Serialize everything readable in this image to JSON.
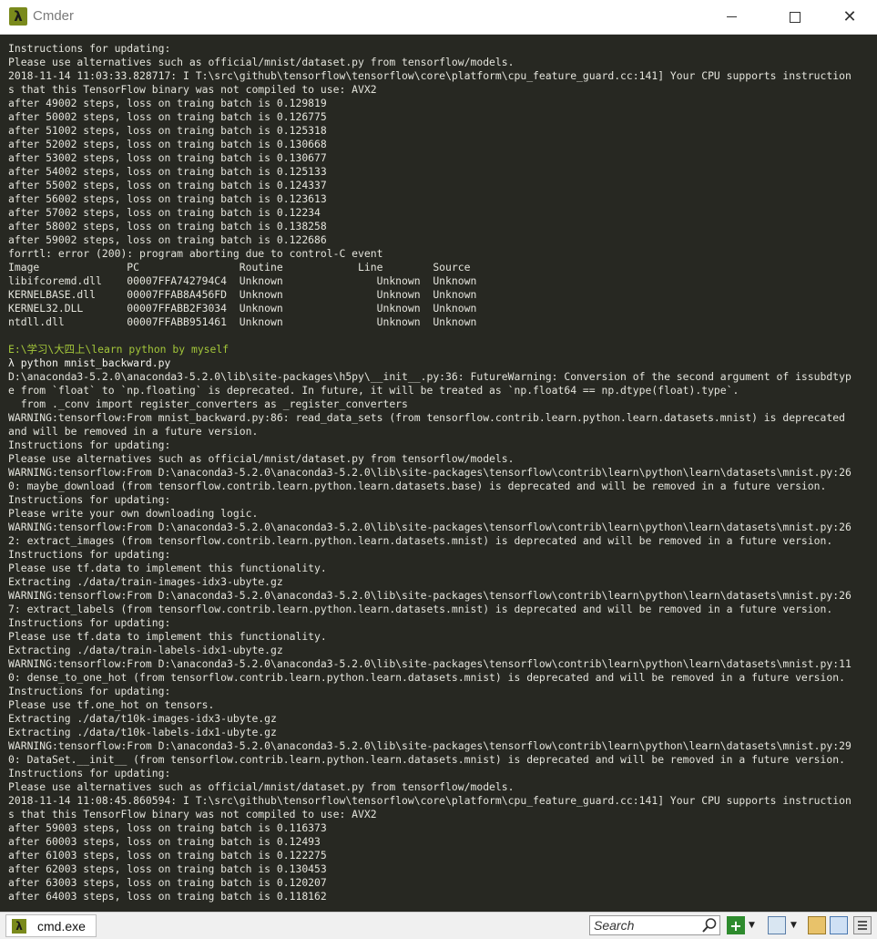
{
  "window": {
    "title": "Cmder",
    "icon_glyph": "λ",
    "minimize_icon": "minimize-icon",
    "maximize_icon": "maximize-icon",
    "close_glyph": "✕"
  },
  "console": {
    "lines": [
      {
        "text": "Instructions for updating:",
        "kind": "text"
      },
      {
        "text": "Please use alternatives such as official/mnist/dataset.py from tensorflow/models.",
        "kind": "text"
      },
      {
        "text": "2018-11-14 11:03:33.828717: I T:\\src\\github\\tensorflow\\tensorflow\\core\\platform\\cpu_feature_guard.cc:141] Your CPU supports instruction",
        "kind": "text"
      },
      {
        "text": "s that this TensorFlow binary was not compiled to use: AVX2",
        "kind": "text"
      },
      {
        "text": "after 49002 steps, loss on traing batch is 0.129819",
        "kind": "text"
      },
      {
        "text": "after 50002 steps, loss on traing batch is 0.126775",
        "kind": "text"
      },
      {
        "text": "after 51002 steps, loss on traing batch is 0.125318",
        "kind": "text"
      },
      {
        "text": "after 52002 steps, loss on traing batch is 0.130668",
        "kind": "text"
      },
      {
        "text": "after 53002 steps, loss on traing batch is 0.130677",
        "kind": "text"
      },
      {
        "text": "after 54002 steps, loss on traing batch is 0.125133",
        "kind": "text"
      },
      {
        "text": "after 55002 steps, loss on traing batch is 0.124337",
        "kind": "text"
      },
      {
        "text": "after 56002 steps, loss on traing batch is 0.123613",
        "kind": "text"
      },
      {
        "text": "after 57002 steps, loss on traing batch is 0.12234",
        "kind": "text"
      },
      {
        "text": "after 58002 steps, loss on traing batch is 0.138258",
        "kind": "text"
      },
      {
        "text": "after 59002 steps, loss on traing batch is 0.122686",
        "kind": "text"
      },
      {
        "text": "forrtl: error (200): program aborting due to control-C event",
        "kind": "text"
      },
      {
        "text": "Image              PC                Routine            Line        Source",
        "kind": "text"
      },
      {
        "text": "libifcoremd.dll    00007FFA742794C4  Unknown               Unknown  Unknown",
        "kind": "text"
      },
      {
        "text": "KERNELBASE.dll     00007FFAB8A456FD  Unknown               Unknown  Unknown",
        "kind": "text"
      },
      {
        "text": "KERNEL32.DLL       00007FFABB2F3034  Unknown               Unknown  Unknown",
        "kind": "text"
      },
      {
        "text": "ntdll.dll          00007FFABB951461  Unknown               Unknown  Unknown",
        "kind": "text"
      },
      {
        "text": "",
        "kind": "text"
      },
      {
        "text": "E:\\学习\\大四上\\learn python by myself",
        "kind": "path"
      },
      {
        "text": "λ python mnist_backward.py",
        "kind": "prompt"
      },
      {
        "text": "D:\\anaconda3-5.2.0\\anaconda3-5.2.0\\lib\\site-packages\\h5py\\__init__.py:36: FutureWarning: Conversion of the second argument of issubdtyp",
        "kind": "text"
      },
      {
        "text": "e from `float` to `np.floating` is deprecated. In future, it will be treated as `np.float64 == np.dtype(float).type`.",
        "kind": "text"
      },
      {
        "text": "  from ._conv import register_converters as _register_converters",
        "kind": "text"
      },
      {
        "text": "WARNING:tensorflow:From mnist_backward.py:86: read_data_sets (from tensorflow.contrib.learn.python.learn.datasets.mnist) is deprecated",
        "kind": "text"
      },
      {
        "text": "and will be removed in a future version.",
        "kind": "text"
      },
      {
        "text": "Instructions for updating:",
        "kind": "text"
      },
      {
        "text": "Please use alternatives such as official/mnist/dataset.py from tensorflow/models.",
        "kind": "text"
      },
      {
        "text": "WARNING:tensorflow:From D:\\anaconda3-5.2.0\\anaconda3-5.2.0\\lib\\site-packages\\tensorflow\\contrib\\learn\\python\\learn\\datasets\\mnist.py:26",
        "kind": "text"
      },
      {
        "text": "0: maybe_download (from tensorflow.contrib.learn.python.learn.datasets.base) is deprecated and will be removed in a future version.",
        "kind": "text"
      },
      {
        "text": "Instructions for updating:",
        "kind": "text"
      },
      {
        "text": "Please write your own downloading logic.",
        "kind": "text"
      },
      {
        "text": "WARNING:tensorflow:From D:\\anaconda3-5.2.0\\anaconda3-5.2.0\\lib\\site-packages\\tensorflow\\contrib\\learn\\python\\learn\\datasets\\mnist.py:26",
        "kind": "text"
      },
      {
        "text": "2: extract_images (from tensorflow.contrib.learn.python.learn.datasets.mnist) is deprecated and will be removed in a future version.",
        "kind": "text"
      },
      {
        "text": "Instructions for updating:",
        "kind": "text"
      },
      {
        "text": "Please use tf.data to implement this functionality.",
        "kind": "text"
      },
      {
        "text": "Extracting ./data/train-images-idx3-ubyte.gz",
        "kind": "text"
      },
      {
        "text": "WARNING:tensorflow:From D:\\anaconda3-5.2.0\\anaconda3-5.2.0\\lib\\site-packages\\tensorflow\\contrib\\learn\\python\\learn\\datasets\\mnist.py:26",
        "kind": "text"
      },
      {
        "text": "7: extract_labels (from tensorflow.contrib.learn.python.learn.datasets.mnist) is deprecated and will be removed in a future version.",
        "kind": "text"
      },
      {
        "text": "Instructions for updating:",
        "kind": "text"
      },
      {
        "text": "Please use tf.data to implement this functionality.",
        "kind": "text"
      },
      {
        "text": "Extracting ./data/train-labels-idx1-ubyte.gz",
        "kind": "text"
      },
      {
        "text": "WARNING:tensorflow:From D:\\anaconda3-5.2.0\\anaconda3-5.2.0\\lib\\site-packages\\tensorflow\\contrib\\learn\\python\\learn\\datasets\\mnist.py:11",
        "kind": "text"
      },
      {
        "text": "0: dense_to_one_hot (from tensorflow.contrib.learn.python.learn.datasets.mnist) is deprecated and will be removed in a future version.",
        "kind": "text"
      },
      {
        "text": "Instructions for updating:",
        "kind": "text"
      },
      {
        "text": "Please use tf.one_hot on tensors.",
        "kind": "text"
      },
      {
        "text": "Extracting ./data/t10k-images-idx3-ubyte.gz",
        "kind": "text"
      },
      {
        "text": "Extracting ./data/t10k-labels-idx1-ubyte.gz",
        "kind": "text"
      },
      {
        "text": "WARNING:tensorflow:From D:\\anaconda3-5.2.0\\anaconda3-5.2.0\\lib\\site-packages\\tensorflow\\contrib\\learn\\python\\learn\\datasets\\mnist.py:29",
        "kind": "text"
      },
      {
        "text": "0: DataSet.__init__ (from tensorflow.contrib.learn.python.learn.datasets.mnist) is deprecated and will be removed in a future version.",
        "kind": "text"
      },
      {
        "text": "Instructions for updating:",
        "kind": "text"
      },
      {
        "text": "Please use alternatives such as official/mnist/dataset.py from tensorflow/models.",
        "kind": "text"
      },
      {
        "text": "2018-11-14 11:08:45.860594: I T:\\src\\github\\tensorflow\\tensorflow\\core\\platform\\cpu_feature_guard.cc:141] Your CPU supports instruction",
        "kind": "text"
      },
      {
        "text": "s that this TensorFlow binary was not compiled to use: AVX2",
        "kind": "text"
      },
      {
        "text": "after 59003 steps, loss on traing batch is 0.116373",
        "kind": "text"
      },
      {
        "text": "after 60003 steps, loss on traing batch is 0.12493",
        "kind": "text"
      },
      {
        "text": "after 61003 steps, loss on traing batch is 0.122275",
        "kind": "text"
      },
      {
        "text": "after 62003 steps, loss on traing batch is 0.130453",
        "kind": "text"
      },
      {
        "text": "after 63003 steps, loss on traing batch is 0.120207",
        "kind": "text"
      },
      {
        "text": "after 64003 steps, loss on traing batch is 0.118162",
        "kind": "text"
      }
    ]
  },
  "taskbar": {
    "tab_label": "cmd.exe",
    "tab_icon_glyph": "λ",
    "search_placeholder": "Search",
    "add_glyph": "+",
    "dropdown_glyph": "▼"
  },
  "colors": {
    "console_bg": "#272822",
    "console_text": "#e4e4dc",
    "path_color": "#a3c63a",
    "accent": "#7a8a1c"
  }
}
